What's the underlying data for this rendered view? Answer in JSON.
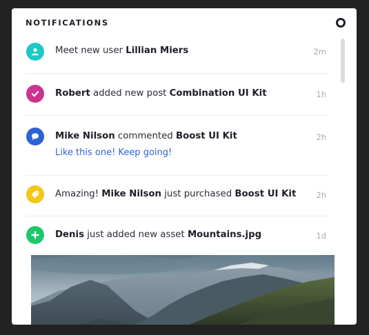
{
  "title": "NOTIFICATIONS",
  "colors": {
    "user": "#1cc8c8",
    "post": "#c9348f",
    "comment": "#2d62d4",
    "purchase": "#f5c518",
    "asset": "#1fc66a",
    "link": "#2d62d4"
  },
  "notifications": [
    {
      "icon": "user-icon",
      "prefix": "Meet new user ",
      "actor": "",
      "middle": "",
      "target": "Lillian Miers",
      "time": "2m"
    },
    {
      "icon": "check-icon",
      "actor": "Robert",
      "middle": " added new post ",
      "target": "Combination UI Kit",
      "time": "1h"
    },
    {
      "icon": "comment-icon",
      "actor": "Mike Nilson",
      "middle": " commented ",
      "target": "Boost UI Kit",
      "comment": "Like this one! Keep going!",
      "time": "2h"
    },
    {
      "icon": "tag-icon",
      "prefix": "Amazing! ",
      "actor": "Mike Nilson",
      "middle": " just purchased ",
      "target": "Boost UI Kit",
      "time": "2h"
    },
    {
      "icon": "plus-icon",
      "actor": "Denis",
      "middle": " just added new asset ",
      "target": "Mountains.jpg",
      "time": "1d"
    }
  ]
}
